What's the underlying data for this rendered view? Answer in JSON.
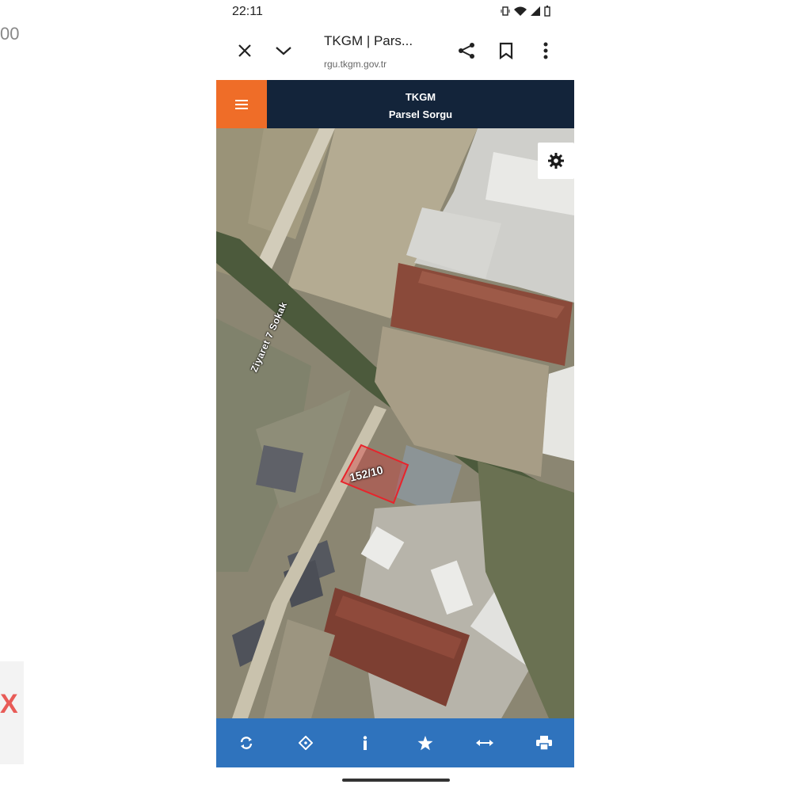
{
  "background": {
    "left_number": "00",
    "left_mark": "X"
  },
  "status_bar": {
    "time": "22:11"
  },
  "browser": {
    "title": "TKGM | Pars...",
    "url": "rgu.tkgm.gov.tr"
  },
  "app": {
    "title": "TKGM",
    "subtitle": "Parsel Sorgu",
    "menu_color": "#ef6d28",
    "header_color": "#13243a"
  },
  "map": {
    "street_label": "Ziyaret 7 Sokak",
    "parcel_label": "152/10",
    "parcel_color": "#d9262c"
  },
  "toolbar": {
    "color": "#2f73bd",
    "items": [
      {
        "icon": "refresh-icon"
      },
      {
        "icon": "locate-icon"
      },
      {
        "icon": "info-icon"
      },
      {
        "icon": "star-icon"
      },
      {
        "icon": "measure-icon"
      },
      {
        "icon": "print-icon"
      }
    ]
  }
}
